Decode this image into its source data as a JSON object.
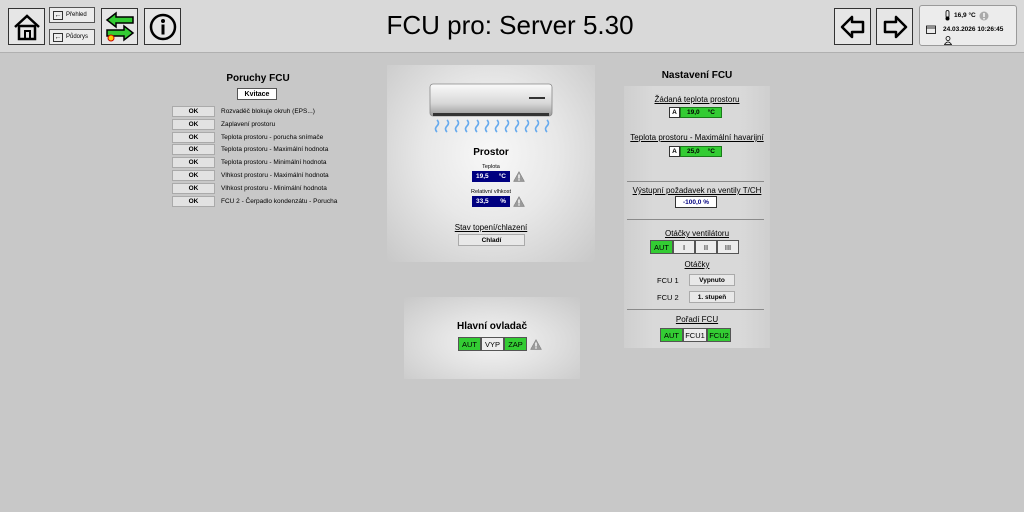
{
  "header": {
    "title": "FCU pro: Server 5.30",
    "prehled_label": "Přehled",
    "pudorys_label": "Půdorys",
    "temperature": "16,9 °C",
    "datetime": "24.03.2026 10:26:45"
  },
  "faults": {
    "title": "Poruchy FCU",
    "ack_label": "Kvitace",
    "items": [
      {
        "status": "OK",
        "text": "Rozvaděč blokuje okruh (EPS...)"
      },
      {
        "status": "OK",
        "text": "Zaplavení prostoru"
      },
      {
        "status": "OK",
        "text": "Teplota prostoru - porucha snímače"
      },
      {
        "status": "OK",
        "text": "Teplota prostoru - Maximální hodnota"
      },
      {
        "status": "OK",
        "text": "Teplota prostoru - Minimální hodnota"
      },
      {
        "status": "OK",
        "text": "Vlhkost prostoru - Maximální hodnota"
      },
      {
        "status": "OK",
        "text": "Vlhkost prostoru - Minimální hodnota"
      },
      {
        "status": "OK",
        "text": "FCU 2 - Čerpadlo kondenzátu - Porucha"
      }
    ]
  },
  "space": {
    "title": "Prostor",
    "temp_label": "Teplota",
    "temp_value": "19,5",
    "temp_unit": "°C",
    "humidity_label": "Relativní vlhkost",
    "humidity_value": "33,5",
    "humidity_unit": "%",
    "mode_label": "Stav topení/chlazení",
    "mode_value": "Chladí"
  },
  "main_control": {
    "title": "Hlavní ovladač",
    "options": [
      "AUT",
      "VYP",
      "ZAP"
    ]
  },
  "settings": {
    "title": "Nastavení FCU",
    "setpoint_label": "Žádaná teplota prostoru",
    "setpoint_mode": "A",
    "setpoint_value": "19,0",
    "setpoint_unit": "°C",
    "emergency_label": "Teplota prostoru - Maximální havarijní",
    "emergency_mode": "A",
    "emergency_value": "25,0",
    "emergency_unit": "°C",
    "valve_label": "Výstupní požadavek na ventily T/CH",
    "valve_value": "-100,0 %",
    "fan_label": "Otáčky ventilátoru",
    "fan_options": [
      "AUT",
      "I",
      "II",
      "III"
    ],
    "speed_label": "Otáčky",
    "fcu1_label": "FCU 1",
    "fcu1_value": "Vypnuto",
    "fcu2_label": "FCU 2",
    "fcu2_value": "1. stupeň",
    "order_label": "Pořadí FCU",
    "order_options": [
      "AUT",
      "FCU1",
      "FCU2"
    ]
  },
  "colors": {
    "active_green": "#33cc33",
    "value_navy": "#000080",
    "background": "#c8c8c8"
  }
}
